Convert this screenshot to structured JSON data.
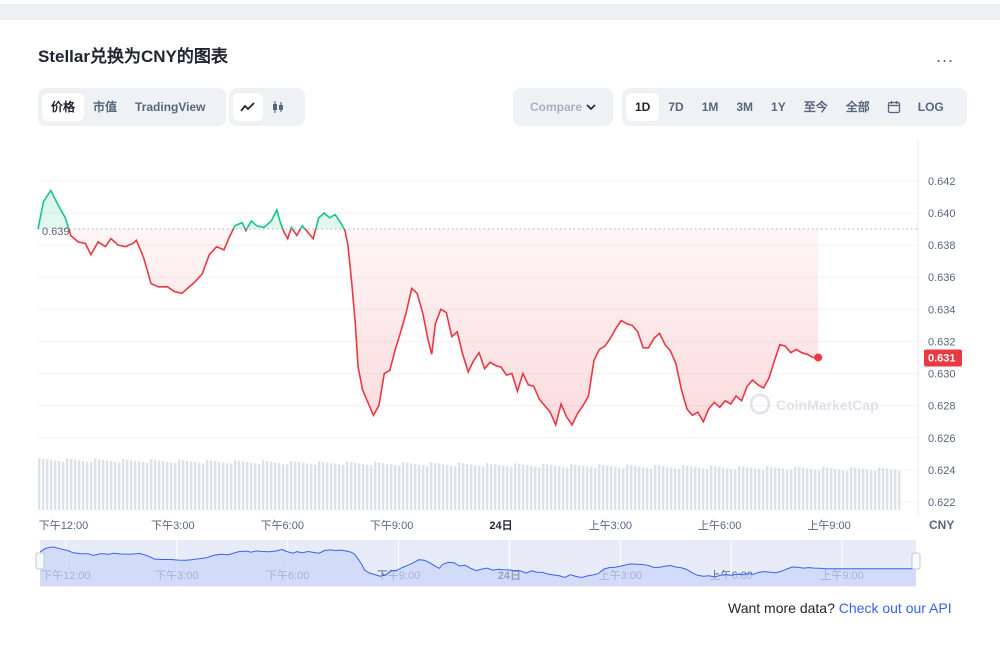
{
  "title": "Stellar兑换为CNY的图表",
  "more_label": "...",
  "view_tabs": [
    {
      "label": "价格",
      "active": true
    },
    {
      "label": "市值",
      "active": false
    },
    {
      "label": "TradingView",
      "active": false
    }
  ],
  "chart_style_icons": [
    "line-chart-icon",
    "candlestick-icon"
  ],
  "compare_label": "Compare",
  "range_tabs": [
    {
      "label": "1D",
      "active": true
    },
    {
      "label": "7D",
      "active": false
    },
    {
      "label": "1M",
      "active": false
    },
    {
      "label": "3M",
      "active": false
    },
    {
      "label": "1Y",
      "active": false
    },
    {
      "label": "至今",
      "active": false
    },
    {
      "label": "全部",
      "active": false
    }
  ],
  "log_label": "LOG",
  "footer": {
    "text": "Want more data? ",
    "link": "Check out our API"
  },
  "watermark": "CoinMarketCap",
  "colors": {
    "up": "#16c784",
    "down": "#ea3943",
    "navigator": "#3861fb",
    "axis_text": "#58667e"
  },
  "chart_data": {
    "type": "area",
    "currency_label": "CNY",
    "reference_price": 0.639,
    "reference_label": "0.639",
    "last_price": 0.631,
    "last_label": "0.631",
    "y_ticks": [
      "0.642",
      "0.640",
      "0.638",
      "0.636",
      "0.634",
      "0.632",
      "0.630",
      "0.628",
      "0.626",
      "0.624",
      "0.622"
    ],
    "ylim": [
      0.6215,
      0.6433
    ],
    "x_ticks": [
      "下午12:00",
      "下午3:00",
      "下午6:00",
      "下午9:00",
      "24日",
      "上午3:00",
      "上午6:00",
      "上午9:00"
    ],
    "x_tick_hours": [
      12,
      15,
      18,
      21,
      24,
      27,
      30,
      33
    ],
    "xlim_hours": [
      11.3,
      35.0
    ],
    "price_series": [
      [
        11.3,
        0.639
      ],
      [
        11.45,
        0.6407
      ],
      [
        11.65,
        0.6414
      ],
      [
        11.85,
        0.6405
      ],
      [
        12.05,
        0.6397
      ],
      [
        12.2,
        0.6386
      ],
      [
        12.4,
        0.6382
      ],
      [
        12.6,
        0.6381
      ],
      [
        12.75,
        0.6374
      ],
      [
        12.95,
        0.6382
      ],
      [
        13.15,
        0.6379
      ],
      [
        13.3,
        0.6384
      ],
      [
        13.5,
        0.638
      ],
      [
        13.7,
        0.6379
      ],
      [
        13.9,
        0.6381
      ],
      [
        14.0,
        0.6383
      ],
      [
        14.2,
        0.6372
      ],
      [
        14.4,
        0.6356
      ],
      [
        14.6,
        0.6354
      ],
      [
        14.85,
        0.6354
      ],
      [
        15.05,
        0.6351
      ],
      [
        15.25,
        0.635
      ],
      [
        15.4,
        0.6353
      ],
      [
        15.6,
        0.6357
      ],
      [
        15.8,
        0.6362
      ],
      [
        16.0,
        0.6374
      ],
      [
        16.2,
        0.6379
      ],
      [
        16.4,
        0.6377
      ],
      [
        16.55,
        0.6385
      ],
      [
        16.7,
        0.6392
      ],
      [
        16.9,
        0.6394
      ],
      [
        17.0,
        0.6389
      ],
      [
        17.15,
        0.6395
      ],
      [
        17.3,
        0.6392
      ],
      [
        17.5,
        0.6391
      ],
      [
        17.7,
        0.6395
      ],
      [
        17.85,
        0.6402
      ],
      [
        17.95,
        0.6394
      ],
      [
        18.05,
        0.6388
      ],
      [
        18.15,
        0.6384
      ],
      [
        18.25,
        0.6391
      ],
      [
        18.4,
        0.6386
      ],
      [
        18.55,
        0.6392
      ],
      [
        18.7,
        0.6388
      ],
      [
        18.85,
        0.6384
      ],
      [
        19.0,
        0.6397
      ],
      [
        19.15,
        0.64
      ],
      [
        19.3,
        0.6397
      ],
      [
        19.45,
        0.6399
      ],
      [
        19.6,
        0.6394
      ],
      [
        19.72,
        0.6389
      ],
      [
        19.8,
        0.638
      ],
      [
        19.9,
        0.6358
      ],
      [
        20.0,
        0.6332
      ],
      [
        20.08,
        0.6304
      ],
      [
        20.2,
        0.629
      ],
      [
        20.35,
        0.6282
      ],
      [
        20.5,
        0.6274
      ],
      [
        20.65,
        0.628
      ],
      [
        20.8,
        0.63
      ],
      [
        20.95,
        0.6302
      ],
      [
        21.1,
        0.6315
      ],
      [
        21.25,
        0.6326
      ],
      [
        21.4,
        0.6338
      ],
      [
        21.55,
        0.6353
      ],
      [
        21.7,
        0.635
      ],
      [
        21.85,
        0.6338
      ],
      [
        22.0,
        0.6321
      ],
      [
        22.1,
        0.6312
      ],
      [
        22.2,
        0.6331
      ],
      [
        22.35,
        0.634
      ],
      [
        22.5,
        0.6338
      ],
      [
        22.65,
        0.6323
      ],
      [
        22.8,
        0.6326
      ],
      [
        22.95,
        0.6312
      ],
      [
        23.1,
        0.6301
      ],
      [
        23.25,
        0.6308
      ],
      [
        23.4,
        0.6313
      ],
      [
        23.55,
        0.6303
      ],
      [
        23.7,
        0.6307
      ],
      [
        23.85,
        0.6305
      ],
      [
        24.0,
        0.6304
      ],
      [
        24.15,
        0.6299
      ],
      [
        24.3,
        0.63
      ],
      [
        24.45,
        0.6289
      ],
      [
        24.6,
        0.63
      ],
      [
        24.75,
        0.6293
      ],
      [
        24.9,
        0.6292
      ],
      [
        25.05,
        0.6284
      ],
      [
        25.2,
        0.628
      ],
      [
        25.35,
        0.6276
      ],
      [
        25.5,
        0.6268
      ],
      [
        25.65,
        0.6281
      ],
      [
        25.8,
        0.6273
      ],
      [
        25.95,
        0.6268
      ],
      [
        26.1,
        0.6275
      ],
      [
        26.25,
        0.628
      ],
      [
        26.4,
        0.6286
      ],
      [
        26.55,
        0.6308
      ],
      [
        26.7,
        0.6315
      ],
      [
        26.85,
        0.6317
      ],
      [
        27.0,
        0.6322
      ],
      [
        27.15,
        0.6328
      ],
      [
        27.3,
        0.6333
      ],
      [
        27.45,
        0.6331
      ],
      [
        27.6,
        0.633
      ],
      [
        27.75,
        0.6326
      ],
      [
        27.9,
        0.6316
      ],
      [
        28.05,
        0.6316
      ],
      [
        28.2,
        0.6322
      ],
      [
        28.35,
        0.6325
      ],
      [
        28.5,
        0.6318
      ],
      [
        28.65,
        0.6314
      ],
      [
        28.8,
        0.6306
      ],
      [
        28.95,
        0.629
      ],
      [
        29.1,
        0.6278
      ],
      [
        29.25,
        0.6274
      ],
      [
        29.4,
        0.6276
      ],
      [
        29.55,
        0.627
      ],
      [
        29.7,
        0.6278
      ],
      [
        29.85,
        0.6282
      ],
      [
        30.0,
        0.6279
      ],
      [
        30.15,
        0.6283
      ],
      [
        30.3,
        0.6281
      ],
      [
        30.45,
        0.6286
      ],
      [
        30.6,
        0.6283
      ],
      [
        30.75,
        0.6292
      ],
      [
        30.9,
        0.6296
      ],
      [
        31.05,
        0.6293
      ],
      [
        31.2,
        0.6291
      ],
      [
        31.35,
        0.6297
      ],
      [
        31.5,
        0.6308
      ],
      [
        31.65,
        0.6318
      ],
      [
        31.8,
        0.6317
      ],
      [
        31.95,
        0.6313
      ],
      [
        32.1,
        0.6315
      ],
      [
        32.25,
        0.6313
      ],
      [
        32.4,
        0.6312
      ],
      [
        32.55,
        0.631
      ],
      [
        32.7,
        0.631
      ]
    ],
    "volume_note": "volume bars shown under price area"
  }
}
